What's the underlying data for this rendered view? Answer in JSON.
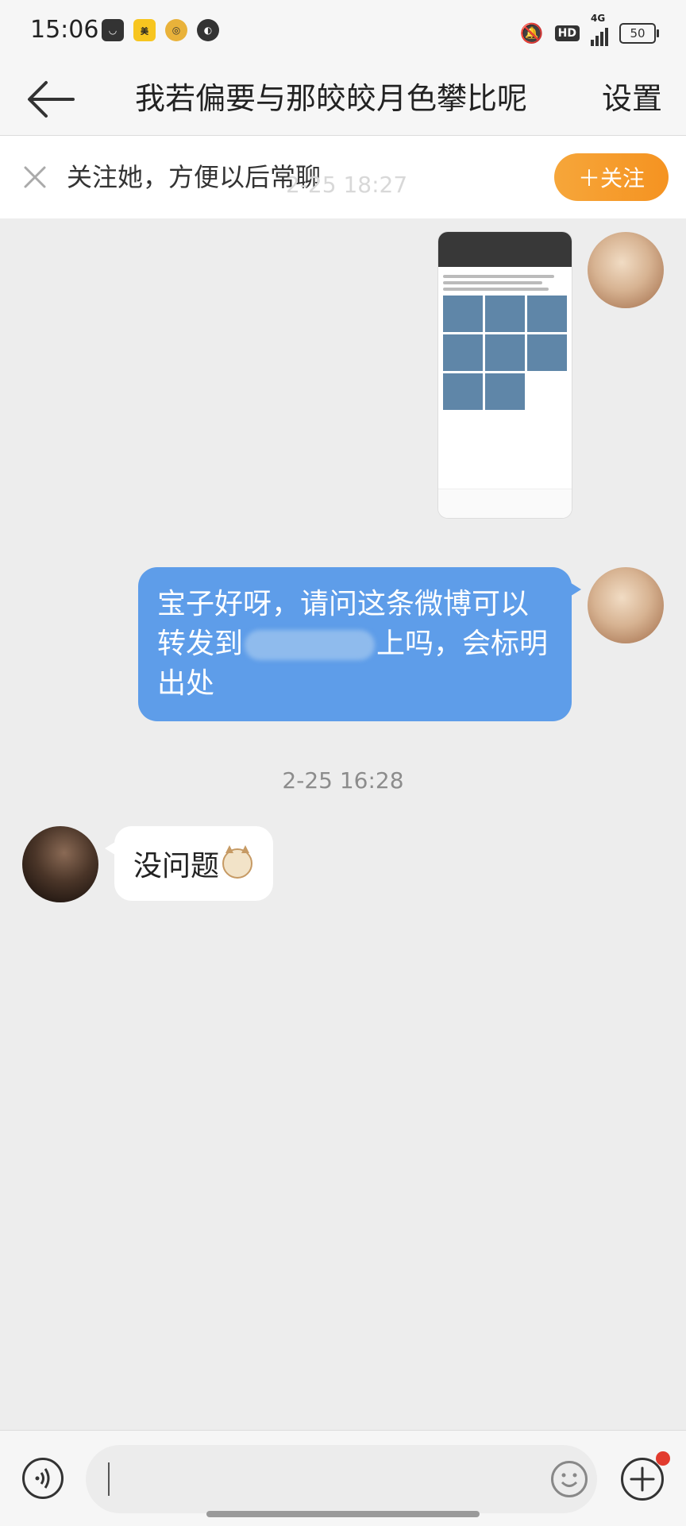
{
  "status": {
    "time": "15:06",
    "left_icons": [
      "bag-icon",
      "meituan-icon",
      "gold-coin-icon",
      "compass-icon"
    ],
    "network_label": "4G",
    "hd_label": "HD",
    "battery": "50"
  },
  "header": {
    "title": "我若偏要与那皎皎月色攀比呢",
    "settings": "设置"
  },
  "follow_bar": {
    "tip": "关注她，方便以后常聊",
    "button": "＋关注",
    "faded_time": "2-25 18:27"
  },
  "messages": [
    {
      "side": "right",
      "type": "image",
      "sender": "me"
    },
    {
      "side": "right",
      "type": "text",
      "sender": "me",
      "text_before": "宝子好呀，请问这条微博可以转发到",
      "text_after": "上吗，会标明出处"
    },
    {
      "type": "timestamp",
      "text": "2-25 16:28"
    },
    {
      "side": "left",
      "type": "text",
      "sender": "other",
      "text": "没问题"
    }
  ],
  "input": {
    "value": "",
    "placeholder": ""
  },
  "colors": {
    "my_bubble": "#5e9de9",
    "follow_button": "#f59321",
    "background": "#ededed"
  }
}
